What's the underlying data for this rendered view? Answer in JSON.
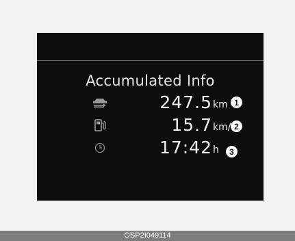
{
  "display": {
    "title": "Accumulated Info",
    "rows": [
      {
        "icon": "car-distance-icon",
        "value": "247.5",
        "unit": "km",
        "marker": "1"
      },
      {
        "icon": "fuel-pump-icon",
        "value": "15.7",
        "unit": "km/L",
        "marker": "2"
      },
      {
        "icon": "clock-icon",
        "value": "17:42",
        "unit": "h",
        "marker": "3"
      }
    ]
  },
  "caption": "OSP2I049114",
  "colors": {
    "panel": "#0d0d0d",
    "text": "#f0f0f0",
    "frame": "#f2f2f2",
    "footer": "#7d7d7d"
  }
}
